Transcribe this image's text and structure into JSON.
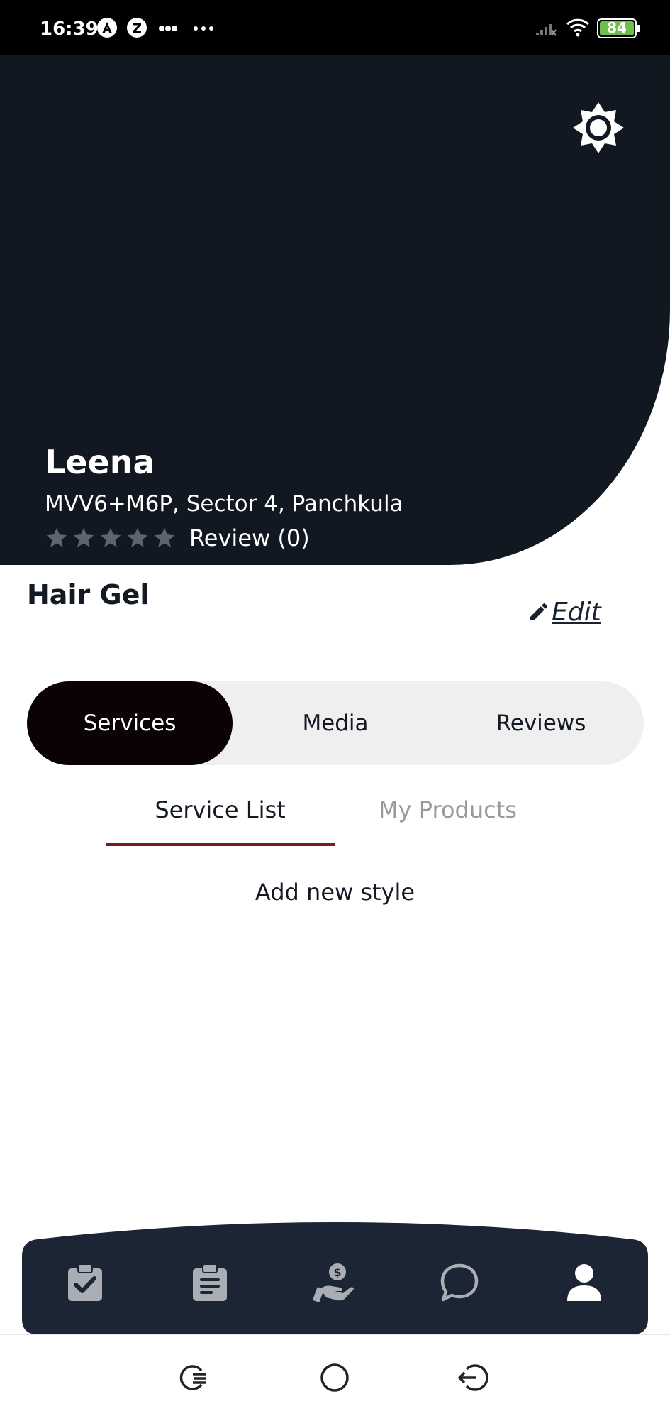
{
  "status_bar": {
    "time": "16:39",
    "battery": "84",
    "icons": [
      "a-circle-icon",
      "z-circle-icon",
      "more-dots-icon",
      "overflow-dots-icon",
      "signal-icon",
      "wifi-icon",
      "battery-icon"
    ]
  },
  "header": {
    "theme_toggle_icon": "brightness-icon",
    "salon_name": "Leena",
    "address": "MVV6+M6P, Sector 4, Panchkula",
    "rating": 0,
    "rating_max": 5,
    "review_label": "Review (0)"
  },
  "style": {
    "title": "Hair Gel",
    "edit_label": "Edit"
  },
  "tabs": [
    {
      "label": "Services",
      "active": true
    },
    {
      "label": "Media",
      "active": false
    },
    {
      "label": "Reviews",
      "active": false
    }
  ],
  "subtabs": [
    {
      "label": "Service List",
      "active": true
    },
    {
      "label": "My Products",
      "active": false
    }
  ],
  "content": {
    "add_new_style": "Add new style"
  },
  "bottom_nav": {
    "items": [
      {
        "icon": "clipboard-check-icon"
      },
      {
        "icon": "clipboard-list-icon"
      },
      {
        "icon": "hand-dollar-icon"
      },
      {
        "icon": "chat-bubble-icon"
      },
      {
        "icon": "user-profile-icon",
        "active": true
      }
    ]
  },
  "system_nav": {
    "items": [
      "recents-icon",
      "home-icon",
      "back-icon"
    ]
  },
  "colors": {
    "hero_background": "#111821",
    "nav_background": "#1b2533",
    "active_tab": "#0a0203",
    "tab_track": "#efefef",
    "subtab_underline": "#7a1c14",
    "battery_fill": "#6cc04a"
  }
}
